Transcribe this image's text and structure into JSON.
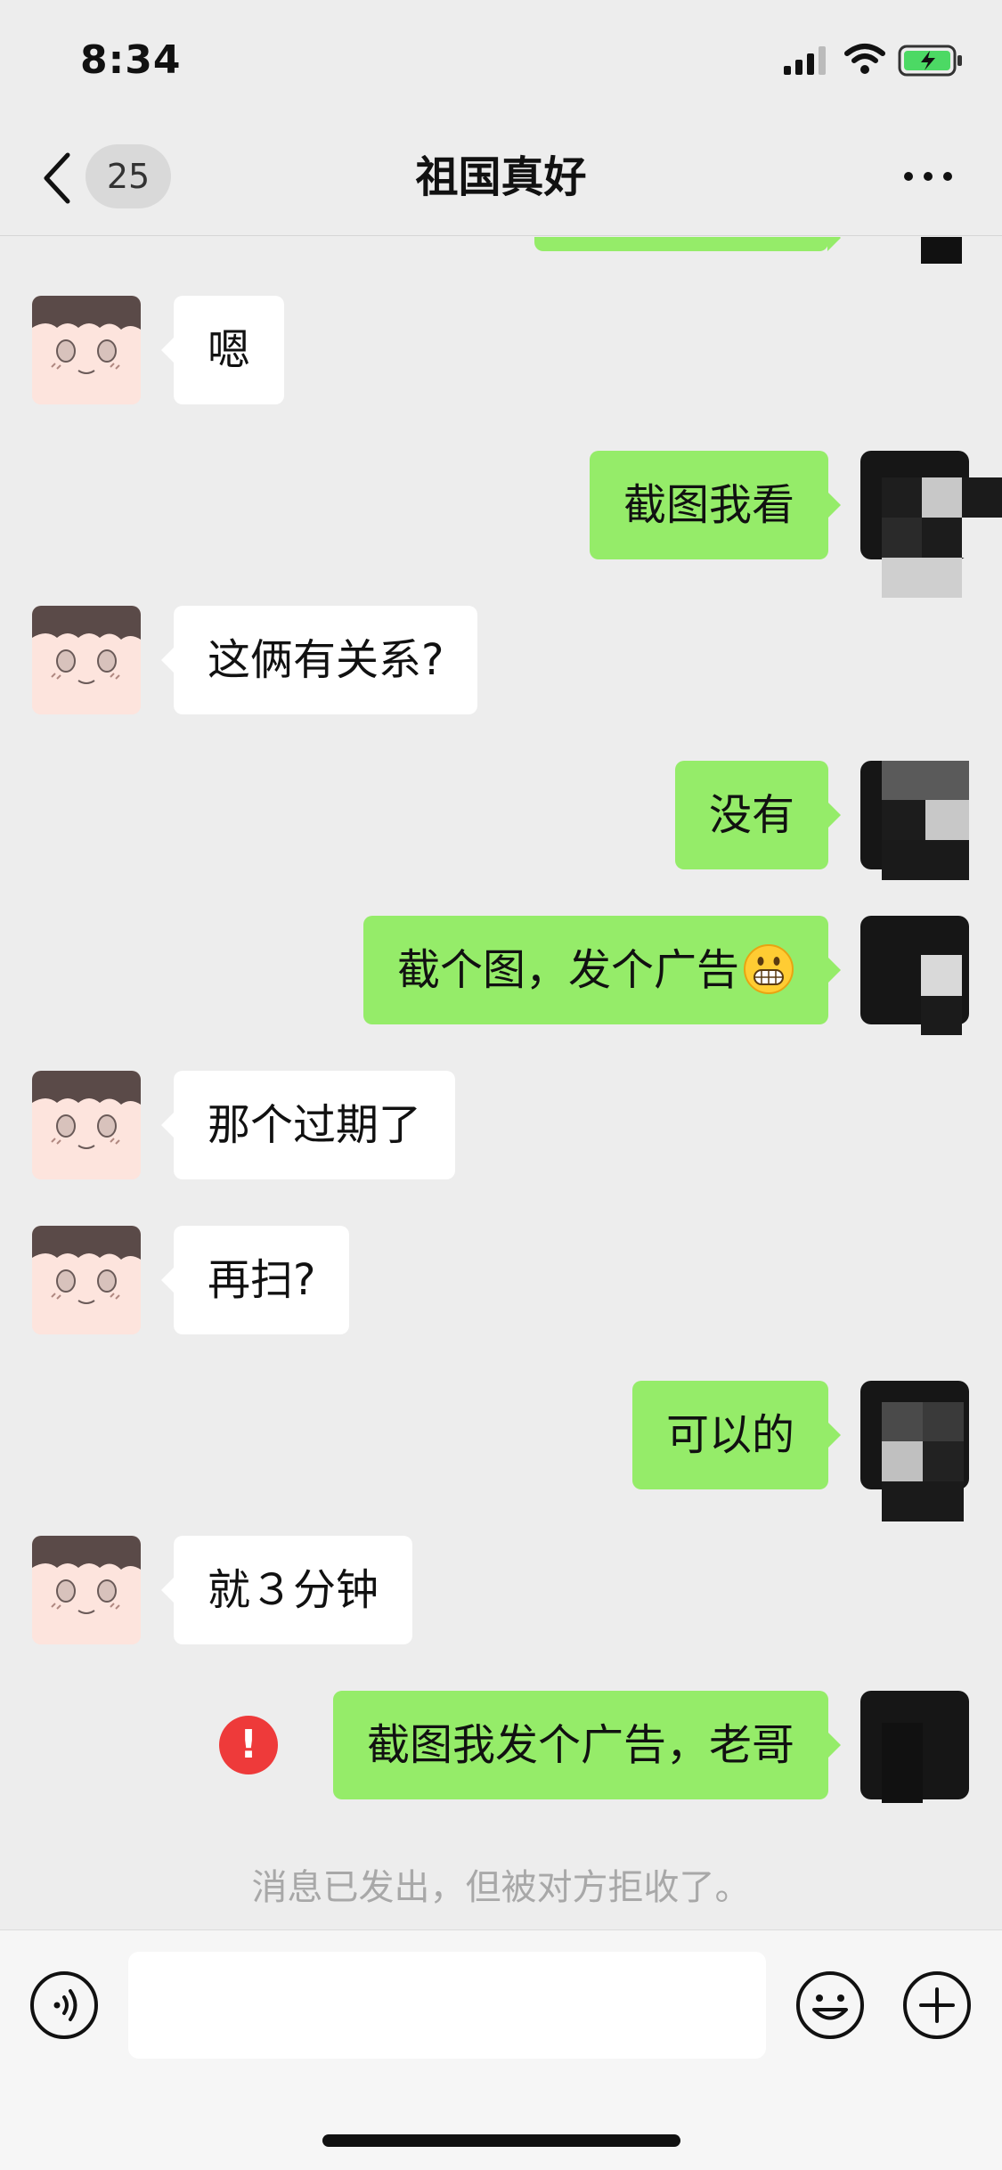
{
  "status_bar": {
    "time": "8:34",
    "icons": [
      "signal-icon",
      "wifi-icon",
      "battery-charging-icon"
    ],
    "battery_color": "#4cd964"
  },
  "nav": {
    "back_icon": "chevron-left-icon",
    "unread_count": "25",
    "title": "祖国真好",
    "more_icon": "more-dots-icon"
  },
  "colors": {
    "background": "#ededed",
    "outgoing_bubble": "#95ec69",
    "incoming_bubble": "#ffffff",
    "error": "#ee3a3a",
    "system_note": "#a8a8a8"
  },
  "messages": [
    {
      "side": "incoming",
      "text": "嗯"
    },
    {
      "side": "outgoing",
      "text": "截图我看"
    },
    {
      "side": "incoming",
      "text": "这俩有关系?"
    },
    {
      "side": "outgoing",
      "text": "没有"
    },
    {
      "side": "outgoing",
      "text": "截个图，发个广告",
      "emoji": "grinning-face-emoji"
    },
    {
      "side": "incoming",
      "text": "那个过期了"
    },
    {
      "side": "incoming",
      "text": "再扫?"
    },
    {
      "side": "outgoing",
      "text": "可以的"
    },
    {
      "side": "incoming",
      "text": "就３分钟"
    },
    {
      "side": "outgoing",
      "text": "截图我发个广告，老哥",
      "status": "rejected"
    }
  ],
  "system_note": "消息已发出，但被对方拒收了。",
  "input_bar": {
    "voice_icon": "voice-icon",
    "input_value": "",
    "emoji_icon": "emoji-icon",
    "plus_icon": "plus-icon"
  }
}
